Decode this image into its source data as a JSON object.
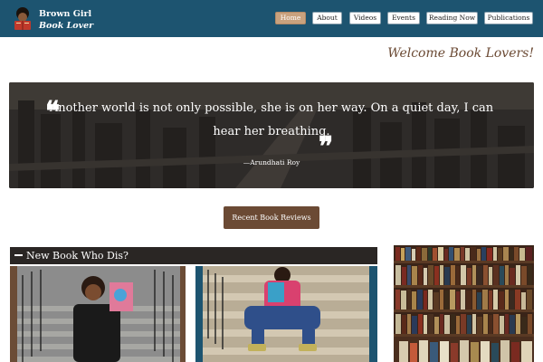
{
  "header": {
    "brand_line1": "Brown Girl",
    "brand_line2": "Book Lover",
    "logo_icon": "girl-reading-book-logo",
    "background_color": "#1d5470"
  },
  "nav": {
    "items": [
      {
        "label": "Home",
        "active": true
      },
      {
        "label": "About",
        "active": false
      },
      {
        "label": "Videos",
        "active": false
      },
      {
        "label": "Events",
        "active": false
      },
      {
        "label": "Reading Now",
        "active": false
      },
      {
        "label": "Publications",
        "active": false
      }
    ],
    "active_color": "#c9a27e"
  },
  "welcome": "Welcome Book Lovers!",
  "hero": {
    "quote": "Another world is not only possible, she is on her way. On a quiet day, I can hear her breathing.",
    "attribution": "—Arundhati Roy"
  },
  "reviews_button": "Recent Book Reviews",
  "accent_color": "#6b4a34",
  "section": {
    "title": "New Book Who Dis?",
    "collapse_icon": "minus-icon"
  }
}
